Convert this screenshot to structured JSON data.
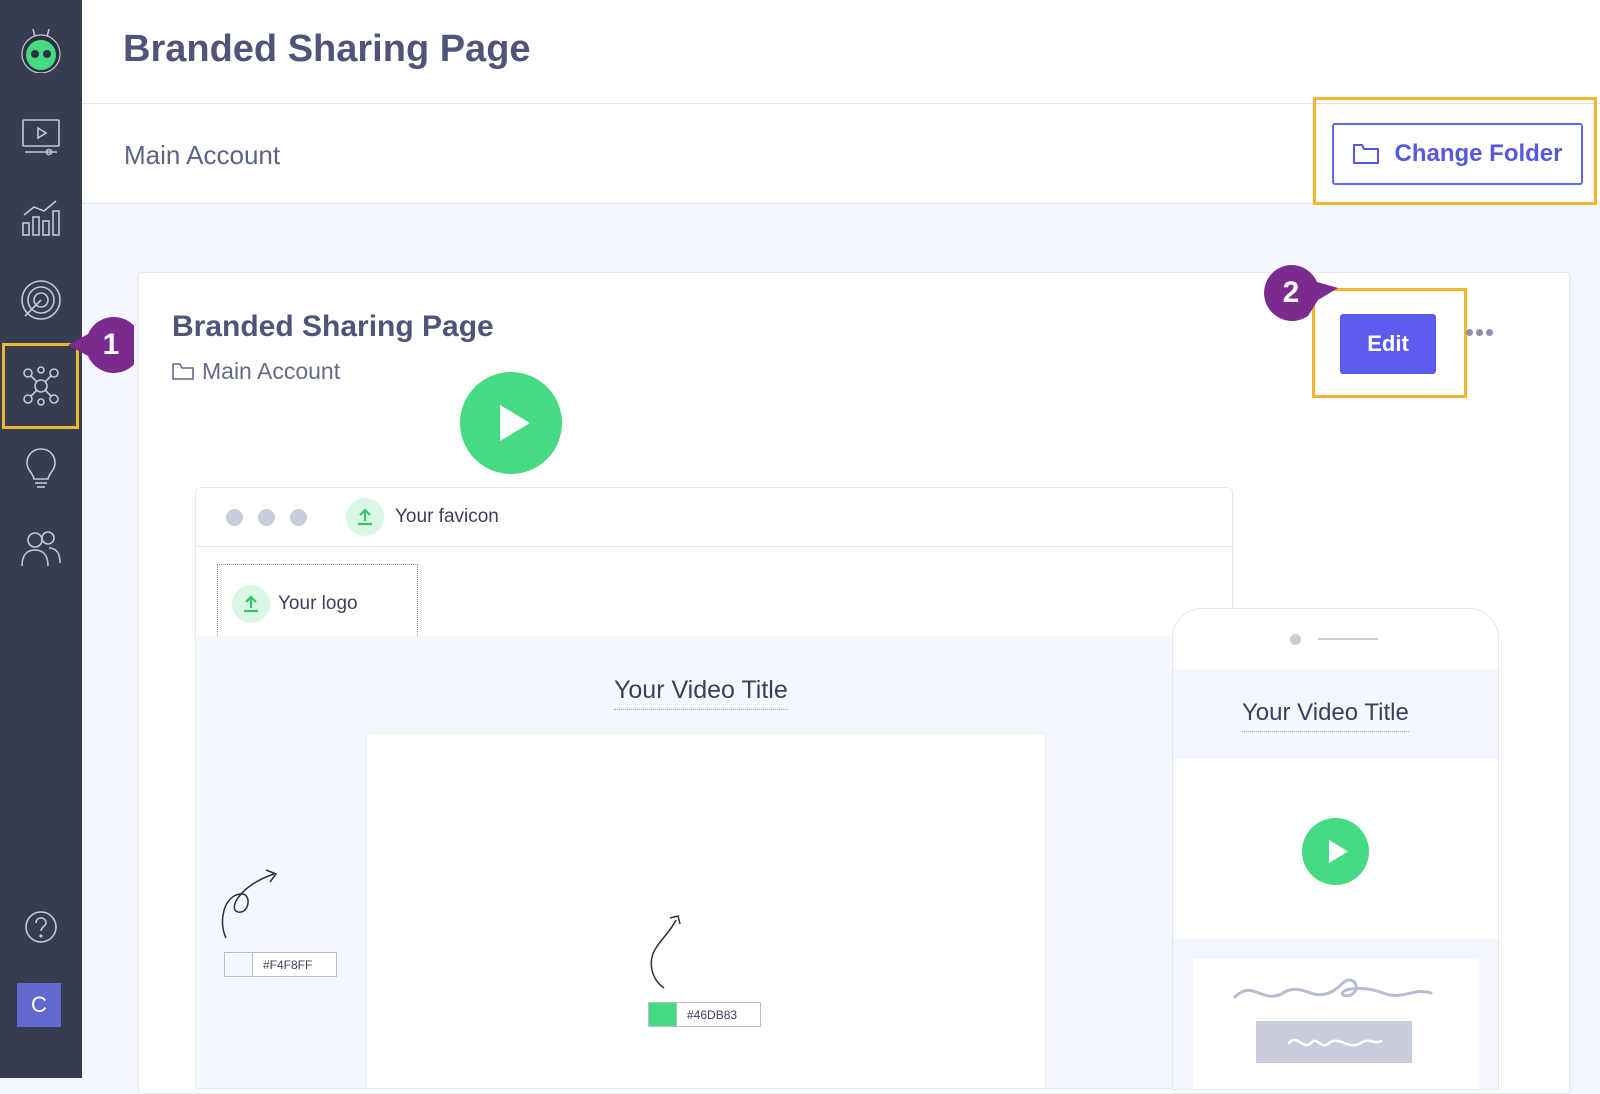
{
  "header": {
    "title": "Branded Sharing Page"
  },
  "breadcrumb": {
    "account": "Main Account"
  },
  "toolbar": {
    "change_folder_label": "Change Folder"
  },
  "card": {
    "title": "Branded Sharing Page",
    "folder": "Main Account",
    "edit_label": "Edit"
  },
  "callouts": {
    "step1": "1",
    "step2": "2"
  },
  "preview": {
    "favicon_label": "Your favicon",
    "logo_label": "Your logo",
    "video_title": "Your Video Title",
    "background_color": "#F4F8FF",
    "button_color": "#46DB83",
    "mobile_video_title": "Your Video Title"
  },
  "sidebar": {
    "items": [
      "logo-icon",
      "videos-icon",
      "analytics-icon",
      "target-icon",
      "integrations-icon",
      "ideas-icon",
      "users-icon",
      "help-icon"
    ],
    "avatar_letter": "C"
  },
  "colors": {
    "accent": "#5b5bf0",
    "highlight": "#f1b631",
    "callout": "#7b2b8f",
    "brand_green": "#46db83",
    "sidebar_bg": "#363d50"
  }
}
